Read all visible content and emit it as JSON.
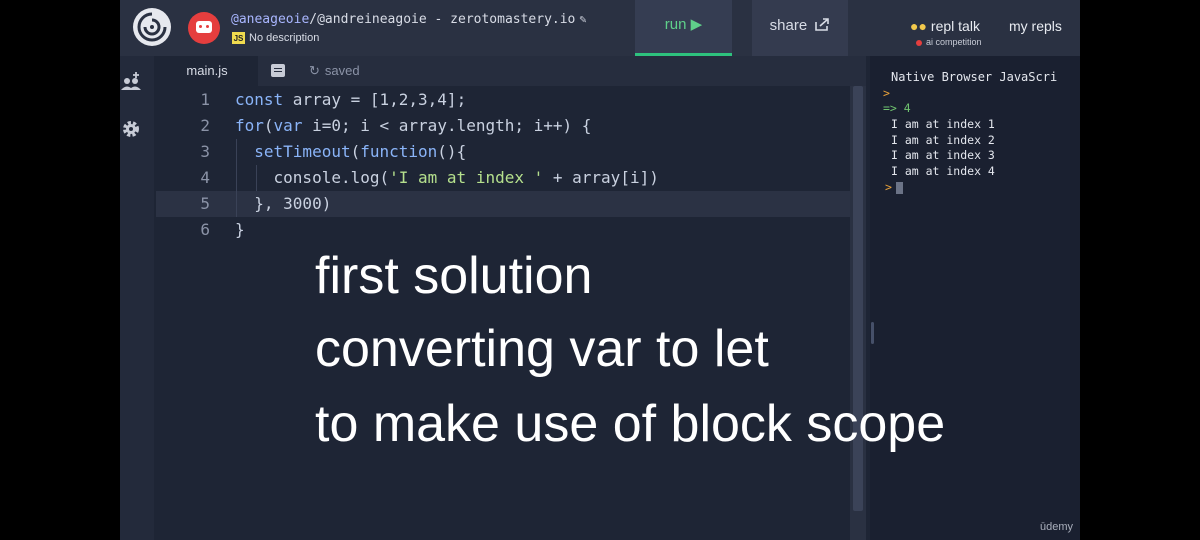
{
  "header": {
    "repl_user": "@aneageoie",
    "repl_path": "/@andreineagoie - zerotomastery.io",
    "lang_badge": "JS",
    "description": "No description",
    "run_label": "run ▶",
    "share_label": "share",
    "repl_talk_label": "repl talk",
    "competition_label": "ai competition",
    "my_repls_label": "my repls"
  },
  "tabs": {
    "active_file": "main.js",
    "save_status": "saved"
  },
  "editor": {
    "active_line": 5,
    "lines": [
      {
        "num": "1",
        "text": "const array = [1,2,3,4];"
      },
      {
        "num": "2",
        "text": "for(var i=0; i < array.length; i++) {"
      },
      {
        "num": "3",
        "text": "  setTimeout(function(){"
      },
      {
        "num": "4",
        "text": "    console.log('I am at index ' + array[i])"
      },
      {
        "num": "5",
        "text": "  }, 3000)"
      },
      {
        "num": "6",
        "text": "}"
      }
    ]
  },
  "console": {
    "title": "Native Browser JavaScri",
    "lines": [
      {
        "prefix": ">",
        "text": ""
      },
      {
        "prefix": "=>",
        "text": " 4"
      },
      {
        "prefix": "",
        "text": "I am at index 1"
      },
      {
        "prefix": "",
        "text": "I am at index 2"
      },
      {
        "prefix": "",
        "text": "I am at index 3"
      },
      {
        "prefix": "",
        "text": "I am at index 4"
      },
      {
        "prefix": ">",
        "text": ""
      }
    ],
    "watermark": "ūdemy"
  },
  "caption": {
    "line1": "first solution",
    "line2": "converting var to let",
    "line3": "to make use of block scope"
  },
  "colors": {
    "accent_run": "#2ec27e",
    "background": "#1e2535",
    "header": "#2a3142"
  },
  "icons": [
    "replit-logo-icon",
    "avatar-icon",
    "pencil-icon",
    "js-badge-icon",
    "play-icon",
    "share-icon",
    "people-icon",
    "add-user-icon",
    "gear-icon",
    "file-icon",
    "clock-icon"
  ]
}
